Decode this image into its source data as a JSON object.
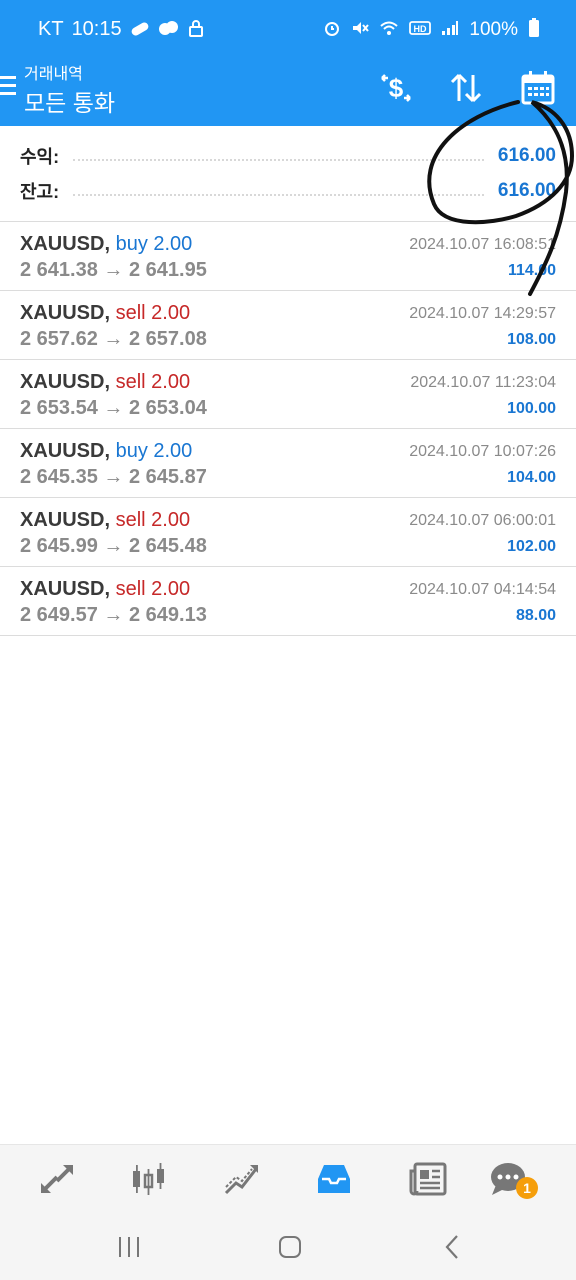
{
  "status_bar": {
    "carrier": "KT",
    "time": "10:15",
    "battery": "100%",
    "left_icons": [
      "pill-icon",
      "cloud-icon",
      "lock-icon"
    ],
    "right_icons": [
      "alarm-icon",
      "mute-icon",
      "wifi-icon",
      "hd-icon",
      "signal-icon",
      "battery-icon"
    ]
  },
  "app_bar": {
    "subtitle": "거래내역",
    "title": "모든 통화",
    "actions": [
      "currency-icon",
      "sort-icon",
      "calendar-icon"
    ]
  },
  "summary": {
    "profit_label": "수익:",
    "profit_value": "616.00",
    "balance_label": "잔고:",
    "balance_value": "616.00"
  },
  "trades": [
    {
      "symbol": "XAUUSD,",
      "type": "buy 2.00",
      "direction": "buy",
      "open": "2 641.38",
      "close": "2 641.95",
      "time": "2024.10.07 16:08:51",
      "profit": "114.00"
    },
    {
      "symbol": "XAUUSD,",
      "type": "sell 2.00",
      "direction": "sell",
      "open": "2 657.62",
      "close": "2 657.08",
      "time": "2024.10.07 14:29:57",
      "profit": "108.00"
    },
    {
      "symbol": "XAUUSD,",
      "type": "sell 2.00",
      "direction": "sell",
      "open": "2 653.54",
      "close": "2 653.04",
      "time": "2024.10.07 11:23:04",
      "profit": "100.00"
    },
    {
      "symbol": "XAUUSD,",
      "type": "buy 2.00",
      "direction": "buy",
      "open": "2 645.35",
      "close": "2 645.87",
      "time": "2024.10.07 10:07:26",
      "profit": "104.00"
    },
    {
      "symbol": "XAUUSD,",
      "type": "sell 2.00",
      "direction": "sell",
      "open": "2 645.99",
      "close": "2 645.48",
      "time": "2024.10.07 06:00:01",
      "profit": "102.00"
    },
    {
      "symbol": "XAUUSD,",
      "type": "sell 2.00",
      "direction": "sell",
      "open": "2 649.57",
      "close": "2 649.13",
      "time": "2024.10.07 04:14:54",
      "profit": "88.00"
    }
  ],
  "arrow": "→",
  "bottom_nav": {
    "items": [
      "quotes-icon",
      "chart-icon",
      "trade-icon",
      "history-icon",
      "news-icon",
      "chat-icon"
    ],
    "active": "history-icon",
    "chat_badge": "1"
  },
  "system_nav": [
    "recents-icon",
    "home-icon",
    "back-icon"
  ],
  "colors": {
    "accent": "#2196f3",
    "buy": "#1976d2",
    "sell": "#c62828",
    "profit": "#1976d2",
    "badge": "#f59e0b"
  }
}
